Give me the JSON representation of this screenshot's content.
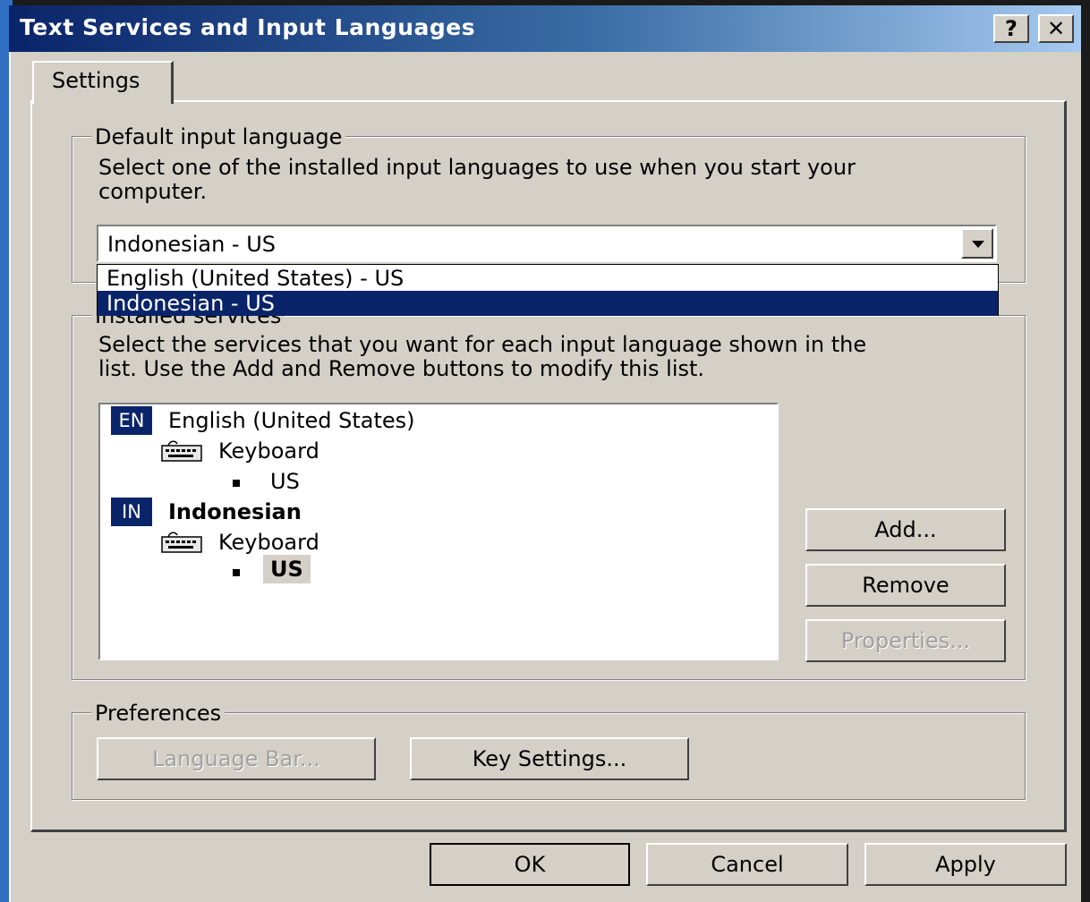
{
  "window": {
    "title": "Text Services and Input Languages",
    "help_label": "?",
    "close_label": "✕"
  },
  "tabs": [
    {
      "label": "Settings"
    }
  ],
  "default_input": {
    "legend": "Default input language",
    "description_line1": "Select one of the installed input languages to use when you start your",
    "description_line2": "computer.",
    "selected_value": "Indonesian - US",
    "options": [
      {
        "label": "English (United States) - US",
        "selected": false
      },
      {
        "label": "Indonesian - US",
        "selected": true
      }
    ]
  },
  "installed_services": {
    "legend": "Installed services",
    "description_line1": "Select the services that you want for each input language shown in the",
    "description_line2": "list. Use the Add and Remove buttons to modify this list.",
    "tree": [
      {
        "badge": "EN",
        "language": "English (United States)",
        "category": "Keyboard",
        "service": "US"
      },
      {
        "badge": "IN",
        "language": "Indonesian",
        "category": "Keyboard",
        "service": "US"
      }
    ],
    "buttons": {
      "add": "Add...",
      "remove": "Remove",
      "properties": "Properties..."
    }
  },
  "preferences": {
    "legend": "Preferences",
    "language_bar": "Language Bar...",
    "key_settings": "Key Settings..."
  },
  "footer": {
    "ok": "OK",
    "cancel": "Cancel",
    "apply": "Apply"
  },
  "colors": {
    "face": "#d4d0c8",
    "selection": "#0a246a",
    "titlebar_start": "#0a246a",
    "titlebar_end": "#a6caf0"
  },
  "icons": {
    "keyboard": "keyboard-icon",
    "dropdown": "chevron-down-icon"
  }
}
